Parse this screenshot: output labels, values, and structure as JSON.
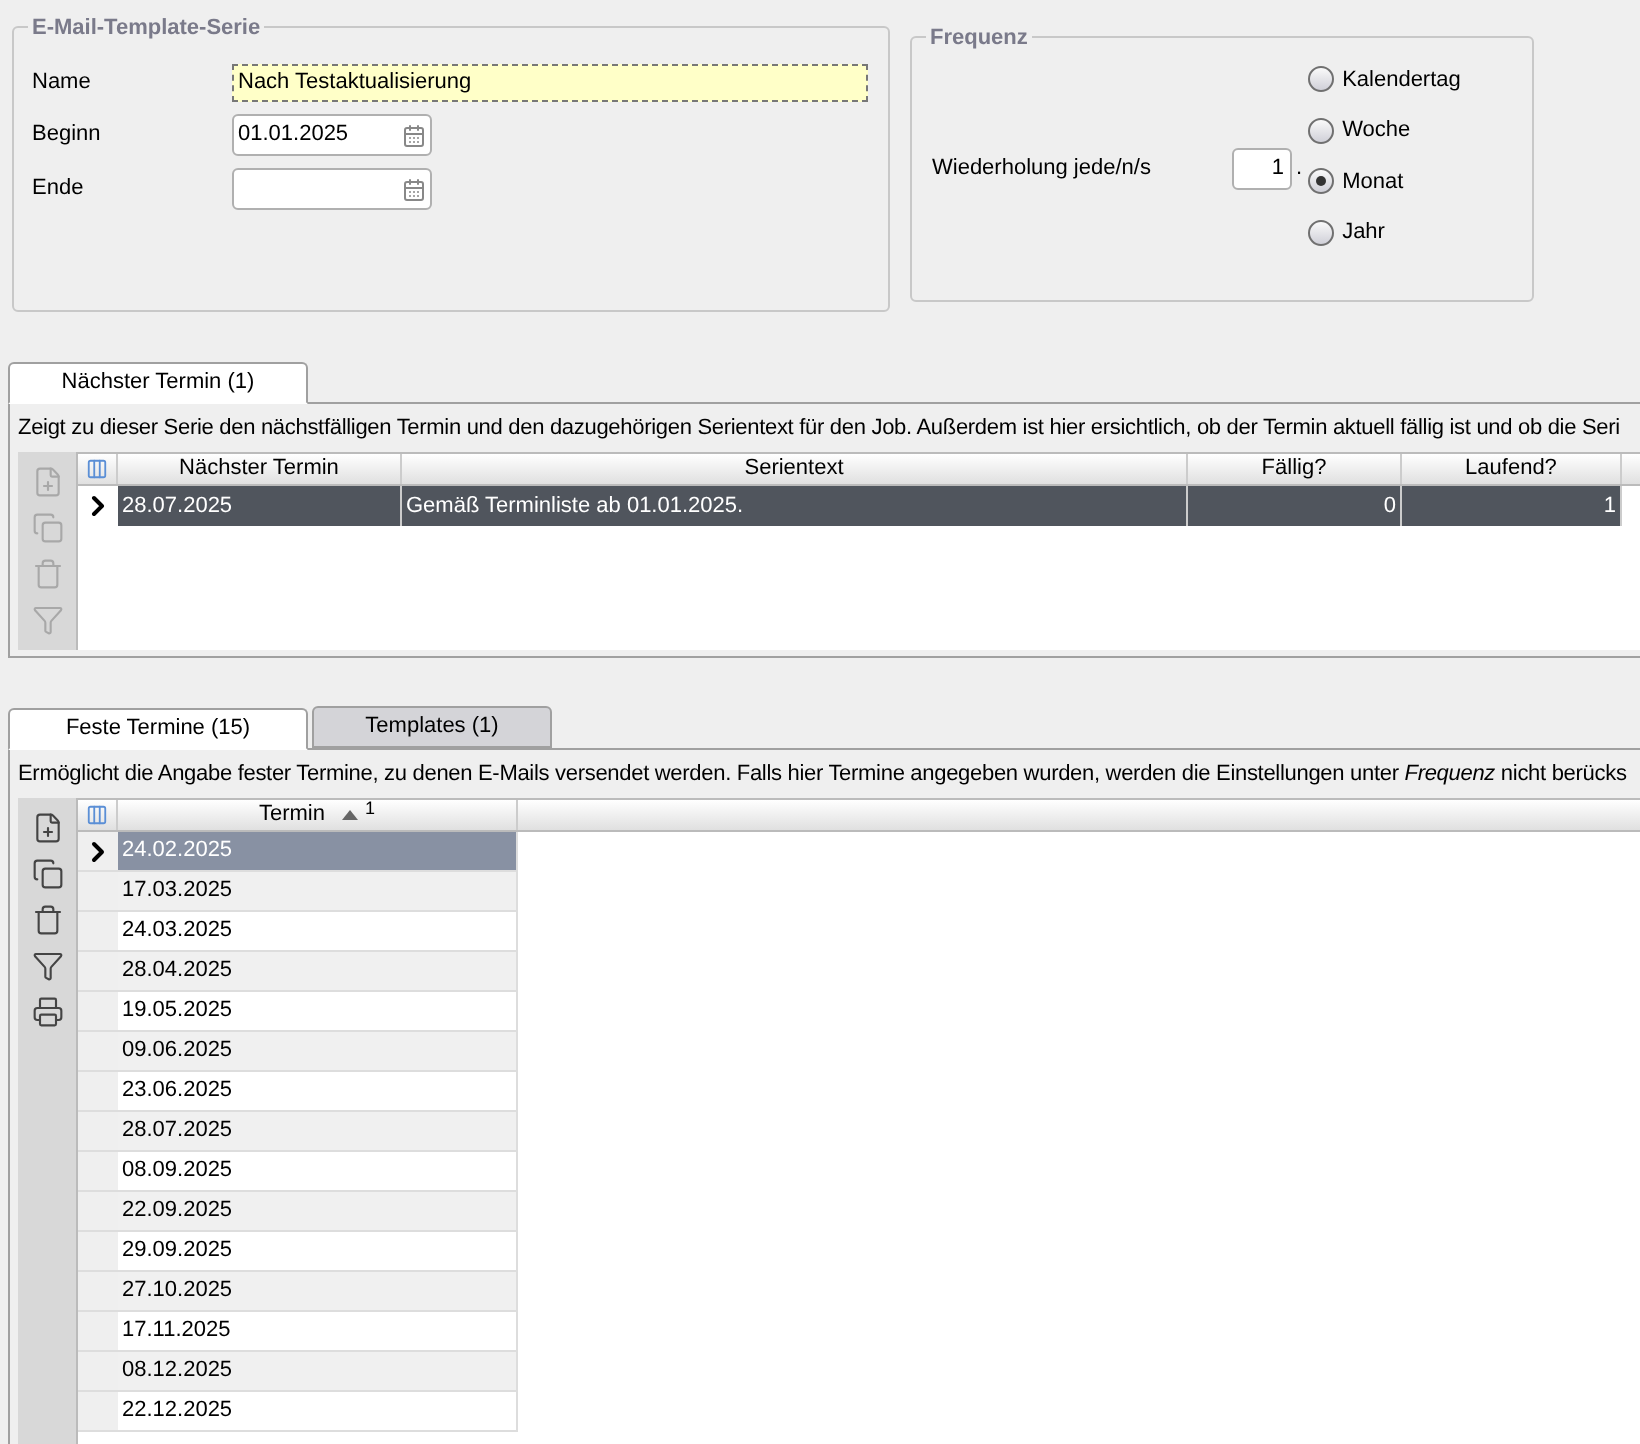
{
  "series_group": {
    "title": "E-Mail-Template-Serie",
    "fields": [
      {
        "label": "Name",
        "value": "Nach Testaktualisierung",
        "kind": "text",
        "focused": true
      },
      {
        "label": "Beginn",
        "value": "01.01.2025",
        "kind": "date",
        "focused": false
      },
      {
        "label": "Ende",
        "kind": "date",
        "focused": false
      }
    ]
  },
  "frequency_group": {
    "title": "Frequenz",
    "label": "Wiederholung jede/n/s",
    "value": "1",
    "suffix": ".",
    "options": [
      {
        "label": "Kalendertag",
        "selected": false
      },
      {
        "label": "Woche",
        "selected": false
      },
      {
        "label": "Monat",
        "selected": true
      },
      {
        "label": "Jahr",
        "selected": false
      }
    ]
  },
  "next_section": {
    "tabs": [
      {
        "label": "Nächster Termin (1)",
        "selected": true
      }
    ],
    "description": "Zeigt zu dieser Serie den nächstfälligen Termin und den dazugehörigen Serientext für den Job. Außerdem ist hier ersichtlich, ob der Termin aktuell fällig ist und ob die Seri",
    "toolbar": [
      {
        "kind": "new",
        "disabled": true
      },
      {
        "kind": "copy",
        "disabled": true
      },
      {
        "kind": "delete",
        "disabled": true
      },
      {
        "kind": "filter",
        "disabled": true
      }
    ],
    "table": {
      "columns": [
        {
          "label": "Nächster Termin"
        },
        {
          "label": "Serientext"
        },
        {
          "label": "Fällig?"
        },
        {
          "label": "Laufend?"
        }
      ],
      "rows": [
        {
          "cells": [
            "28.07.2025",
            "Gemäß Terminliste ab 01.01.2025.",
            "0",
            "1"
          ],
          "selected": true
        }
      ]
    }
  },
  "fixed_section": {
    "tabs": [
      {
        "label": "Feste Termine (15)",
        "selected": true
      },
      {
        "label": "Templates (1)",
        "selected": false
      }
    ],
    "description": "Ermöglicht die Angabe fester Termine, zu denen E-Mails versendet werden. Falls hier Termine angegeben wurden, werden die Einstellungen unter *Frequenz* nicht berücks",
    "toolbar": [
      {
        "kind": "new",
        "disabled": false
      },
      {
        "kind": "copy",
        "disabled": false
      },
      {
        "kind": "delete",
        "disabled": false
      },
      {
        "kind": "filter",
        "disabled": false
      },
      {
        "kind": "print",
        "disabled": false
      }
    ],
    "table": {
      "columns": [
        {
          "label": "Termin",
          "sort_index": "1"
        }
      ],
      "rows": [
        {
          "cells": [
            "24.02.2025"
          ],
          "selected": true
        },
        {
          "cells": [
            "17.03.2025"
          ],
          "selected": false
        },
        {
          "cells": [
            "24.03.2025"
          ],
          "selected": false
        },
        {
          "cells": [
            "28.04.2025"
          ],
          "selected": false
        },
        {
          "cells": [
            "19.05.2025"
          ],
          "selected": false
        },
        {
          "cells": [
            "09.06.2025"
          ],
          "selected": false
        },
        {
          "cells": [
            "23.06.2025"
          ],
          "selected": false
        },
        {
          "cells": [
            "28.07.2025"
          ],
          "selected": false
        },
        {
          "cells": [
            "08.09.2025"
          ],
          "selected": false
        },
        {
          "cells": [
            "22.09.2025"
          ],
          "selected": false
        },
        {
          "cells": [
            "29.09.2025"
          ],
          "selected": false
        },
        {
          "cells": [
            "27.10.2025"
          ],
          "selected": false
        },
        {
          "cells": [
            "17.11.2025"
          ],
          "selected": false
        },
        {
          "cells": [
            "08.12.2025"
          ],
          "selected": false
        },
        {
          "cells": [
            "22.12.2025"
          ],
          "selected": false
        }
      ]
    }
  }
}
